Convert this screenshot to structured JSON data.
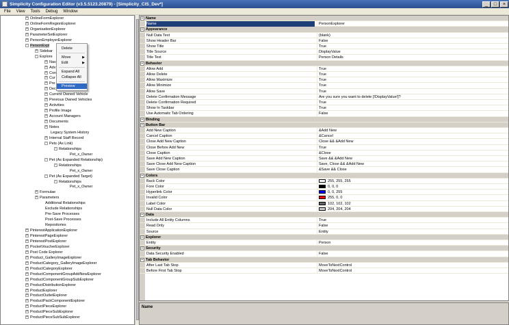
{
  "window": {
    "title": "Simplicity Configuration Editor (v3.5.5123.20879) - [Simplicity_CIS_Dev*]"
  },
  "menu": [
    "File",
    "View",
    "Tools",
    "Debug",
    "Window"
  ],
  "tree": [
    {
      "label": "OnlineFormExplorer",
      "indent": 36,
      "exp": "+"
    },
    {
      "label": "OnlineFormRegionExplorer",
      "indent": 36,
      "exp": "+"
    },
    {
      "label": "OrganisationExplorer",
      "indent": 36,
      "exp": "+"
    },
    {
      "label": "ParameterSetExplorer",
      "indent": 36,
      "exp": "+"
    },
    {
      "label": "PersonEmployerExplorer",
      "indent": 36,
      "exp": "+"
    },
    {
      "label": "PersonExpl",
      "indent": 36,
      "exp": "-",
      "selected": true
    },
    {
      "label": "Sidebar",
      "indent": 50,
      "exp": "+"
    },
    {
      "label": "Explore",
      "indent": 50,
      "exp": "-"
    },
    {
      "label": "Nav",
      "indent": 64,
      "exp": "+"
    },
    {
      "label": "Adv",
      "indent": 64,
      "exp": "+"
    },
    {
      "label": "Con",
      "indent": 64,
      "exp": "+"
    },
    {
      "label": "Cur",
      "indent": 64,
      "exp": "+"
    },
    {
      "label": "Pre",
      "indent": 64,
      "exp": "+"
    },
    {
      "label": "Dec",
      "indent": 64,
      "exp": "+"
    },
    {
      "label": "Current Owned Vehicle",
      "indent": 64,
      "exp": "+"
    },
    {
      "label": "Previous Owned Vehicles",
      "indent": 64,
      "exp": "+"
    },
    {
      "label": "Activities",
      "indent": 64,
      "exp": "+"
    },
    {
      "label": "Profile Image",
      "indent": 64,
      "exp": "+"
    },
    {
      "label": "Account Managers",
      "indent": 64,
      "exp": "+"
    },
    {
      "label": "Documents",
      "indent": 64,
      "exp": "+"
    },
    {
      "label": "Notes",
      "indent": 64,
      "exp": "+"
    },
    {
      "label": "Legacy System History",
      "indent": 64,
      "exp": ""
    },
    {
      "label": "Internal Staff Record",
      "indent": 64,
      "exp": "+"
    },
    {
      "label": "Pets (As Link)",
      "indent": 64,
      "exp": "-"
    },
    {
      "label": "Relationships",
      "indent": 78,
      "exp": "-"
    },
    {
      "label": "Pet_x_Owner",
      "indent": 92,
      "exp": ""
    },
    {
      "label": "Pet (As Expanded Relationship)",
      "indent": 64,
      "exp": "-"
    },
    {
      "label": "Relationships",
      "indent": 78,
      "exp": "-"
    },
    {
      "label": "Pet_x_Owner",
      "indent": 92,
      "exp": ""
    },
    {
      "label": "Pet (As Expanded Target)",
      "indent": 64,
      "exp": "-"
    },
    {
      "label": "Relationships",
      "indent": 78,
      "exp": "-"
    },
    {
      "label": "Pet_x_Owner",
      "indent": 92,
      "exp": ""
    },
    {
      "label": "Formulae",
      "indent": 50,
      "exp": "+"
    },
    {
      "label": "Parameters",
      "indent": 50,
      "exp": "+"
    },
    {
      "label": "Additional Relationships",
      "indent": 56,
      "exp": ""
    },
    {
      "label": "Exclude Relationships",
      "indent": 56,
      "exp": ""
    },
    {
      "label": "Pre-Save Processes",
      "indent": 56,
      "exp": ""
    },
    {
      "label": "Post-Save Processes",
      "indent": 56,
      "exp": ""
    },
    {
      "label": "Repositories",
      "indent": 56,
      "exp": ""
    },
    {
      "label": "PinterestApplicationExplorer",
      "indent": 36,
      "exp": "+"
    },
    {
      "label": "PinterestPageExplorer",
      "indent": 36,
      "exp": "+"
    },
    {
      "label": "PinterestPostExplorer",
      "indent": 36,
      "exp": "+"
    },
    {
      "label": "PocketVoucherExplorer",
      "indent": 36,
      "exp": "+"
    },
    {
      "label": "Post Code Explorer",
      "indent": 36,
      "exp": "+"
    },
    {
      "label": "Product_GalleryImageExplorer",
      "indent": 36,
      "exp": "+"
    },
    {
      "label": "ProductCategory_GalleryImageExplorer",
      "indent": 36,
      "exp": "+"
    },
    {
      "label": "ProductCategoryExplorer",
      "indent": 36,
      "exp": "+"
    },
    {
      "label": "ProductComponentGroupAddNewExplorer",
      "indent": 36,
      "exp": "+"
    },
    {
      "label": "ProductComponentGroupSubExplorer",
      "indent": 36,
      "exp": "+"
    },
    {
      "label": "ProductDistributionExplorer",
      "indent": 36,
      "exp": "+"
    },
    {
      "label": "ProductExplorer",
      "indent": 36,
      "exp": "+"
    },
    {
      "label": "ProductOutletExplorer",
      "indent": 36,
      "exp": "+"
    },
    {
      "label": "ProductPackComponentExplorer",
      "indent": 36,
      "exp": "+"
    },
    {
      "label": "ProductPieceExplorer",
      "indent": 36,
      "exp": "+"
    },
    {
      "label": "ProductPieceSubExplorer",
      "indent": 36,
      "exp": "+"
    },
    {
      "label": "ProductPieceSubSubExplorer",
      "indent": 36,
      "exp": "+"
    }
  ],
  "context_menu": {
    "delete": "Delete",
    "move": "Move",
    "edit": "Edit",
    "expand_all": "Expand All",
    "collapse_all": "Collapse All",
    "preview": "Preview"
  },
  "properties": [
    {
      "cat": "Name"
    },
    {
      "k": "Name",
      "v": "PersonExplorer",
      "selected": true
    },
    {
      "cat": "Appearance"
    },
    {
      "k": "Null Data Text",
      "v": "(blank)"
    },
    {
      "k": "Show Header Bar",
      "v": "False"
    },
    {
      "k": "Show Title",
      "v": "True"
    },
    {
      "k": "Title Source",
      "v": "DisplayValue"
    },
    {
      "k": "Title Text",
      "v": "Person Details"
    },
    {
      "cat": "Behavior"
    },
    {
      "k": "Allow Add",
      "v": "True"
    },
    {
      "k": "Allow Delete",
      "v": "True"
    },
    {
      "k": "Allow Maximize",
      "v": "True"
    },
    {
      "k": "Allow Minimize",
      "v": "True"
    },
    {
      "k": "Allow Save",
      "v": "True"
    },
    {
      "k": "Delete Confirmation Message",
      "v": "Are you sure you want to delete [!DisplayValue!]?"
    },
    {
      "k": "Delete Confirmation Required",
      "v": "True"
    },
    {
      "k": "Show In Taskbar",
      "v": "True"
    },
    {
      "k": "Use Automatic Tab Ordering",
      "v": "False"
    },
    {
      "cat": "Binding"
    },
    {
      "cat": "Button Bar"
    },
    {
      "k": "Add New Caption",
      "v": "&Add New"
    },
    {
      "k": "Cancel Caption",
      "v": "&Cancel"
    },
    {
      "k": "Close Add New Caption",
      "v": "Close && &Add New"
    },
    {
      "k": "Close Before Add New",
      "v": "True"
    },
    {
      "k": "Close Caption",
      "v": "&Close"
    },
    {
      "k": "Save Add New Caption",
      "v": "Save && &Add New"
    },
    {
      "k": "Save Close Add New Caption",
      "v": "Save, Close && &Add New"
    },
    {
      "k": "Save Close Caption",
      "v": "&Save && Close"
    },
    {
      "cat": "Colors"
    },
    {
      "k": "Back Color",
      "v": "255, 255, 255",
      "swatch": "#ffffff"
    },
    {
      "k": "Fore Color",
      "v": "0, 0, 0",
      "swatch": "#000000"
    },
    {
      "k": "Hyperlink Color",
      "v": "0, 0, 255",
      "swatch": "#0000ff"
    },
    {
      "k": "Invalid Color",
      "v": "255, 0, 0",
      "swatch": "#ff0000"
    },
    {
      "k": "Label Color",
      "v": "102, 102, 102",
      "swatch": "#666666"
    },
    {
      "k": "Null Data Color",
      "v": "204, 204, 204",
      "swatch": "#cccccc"
    },
    {
      "cat": "Data"
    },
    {
      "k": "Include All Entity Columns",
      "v": "True"
    },
    {
      "k": "Read Only",
      "v": "False"
    },
    {
      "k": "Source",
      "v": "Entity"
    },
    {
      "cat": "Explorer"
    },
    {
      "k": "Entity",
      "v": "Person"
    },
    {
      "cat": "Security"
    },
    {
      "k": "Data Security Enabled",
      "v": "False"
    },
    {
      "cat": "Tab Behavior"
    },
    {
      "k": "After Last Tab Stop",
      "v": "MoveToNextControl"
    },
    {
      "k": "Before First Tab Stop",
      "v": "MoveToNextControl"
    }
  ],
  "description": {
    "title": "Name"
  }
}
